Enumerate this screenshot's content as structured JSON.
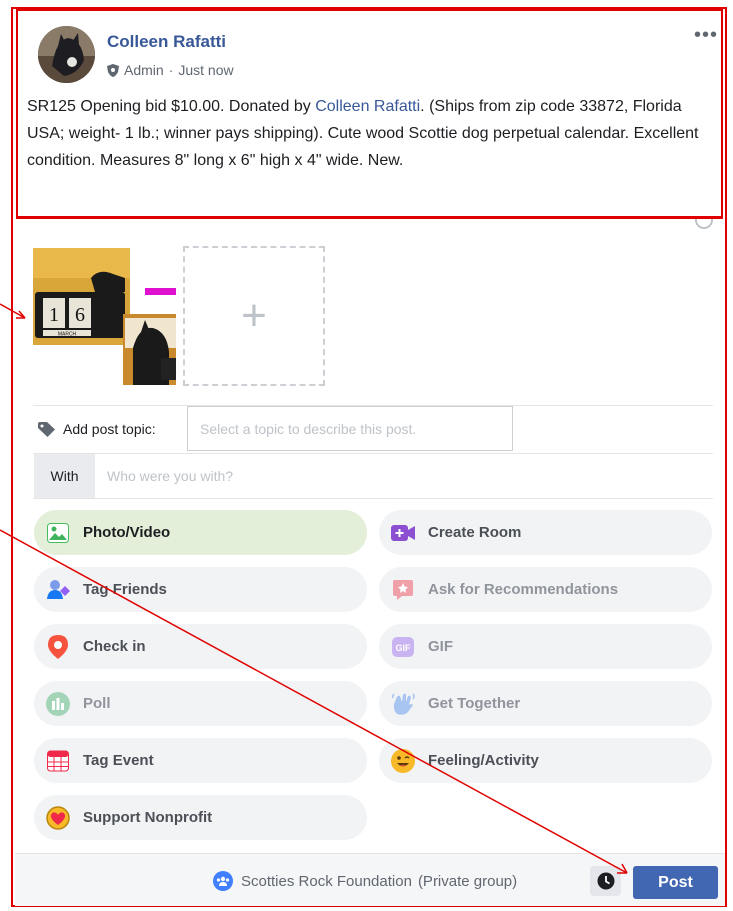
{
  "post": {
    "author": "Colleen Rafatti",
    "role": "Admin",
    "time": "Just now",
    "text_before_link": "SR125 Opening bid $10.00. Donated by ",
    "text_link": "Colleen Rafatti",
    "text_after_link": ". (Ships from zip code 33872, Florida USA; weight- 1 lb.; winner pays shipping). Cute wood Scottie dog perpetual calendar. Excellent condition. Measures 8\" long x 6\" high x 4\" wide. New.",
    "more_icon": "more-dots-icon"
  },
  "photos": {
    "thumb_text": "1 6",
    "thumb_month": "MARCH",
    "add_symbol": "+"
  },
  "topic": {
    "label": "Add post topic:",
    "placeholder": "Select a topic to describe this post."
  },
  "with": {
    "tag": "With",
    "placeholder": "Who were you with?"
  },
  "actions": [
    {
      "label": "Photo/Video",
      "icon": "photo-icon"
    },
    {
      "label": "Create Room",
      "icon": "room-icon"
    },
    {
      "label": "Tag Friends",
      "icon": "tag-friends-icon"
    },
    {
      "label": "Ask for Recommendations",
      "icon": "recommendations-icon"
    },
    {
      "label": "Check in",
      "icon": "location-pin-icon"
    },
    {
      "label": "GIF",
      "icon": "gif-icon"
    },
    {
      "label": "Poll",
      "icon": "poll-icon"
    },
    {
      "label": "Get Together",
      "icon": "hand-wave-icon"
    },
    {
      "label": "Tag Event",
      "icon": "calendar-icon"
    },
    {
      "label": "Feeling/Activity",
      "icon": "smile-icon"
    },
    {
      "label": "Support Nonprofit",
      "icon": "heart-badge-icon"
    }
  ],
  "footer": {
    "group_name": "Scotties Rock Foundation",
    "group_privacy": "(Private group)",
    "post_button": "Post"
  },
  "colors": {
    "brand": "#4267b2",
    "link": "#385898",
    "annotation": "#e00000",
    "active_pill": "#e3efd8"
  }
}
